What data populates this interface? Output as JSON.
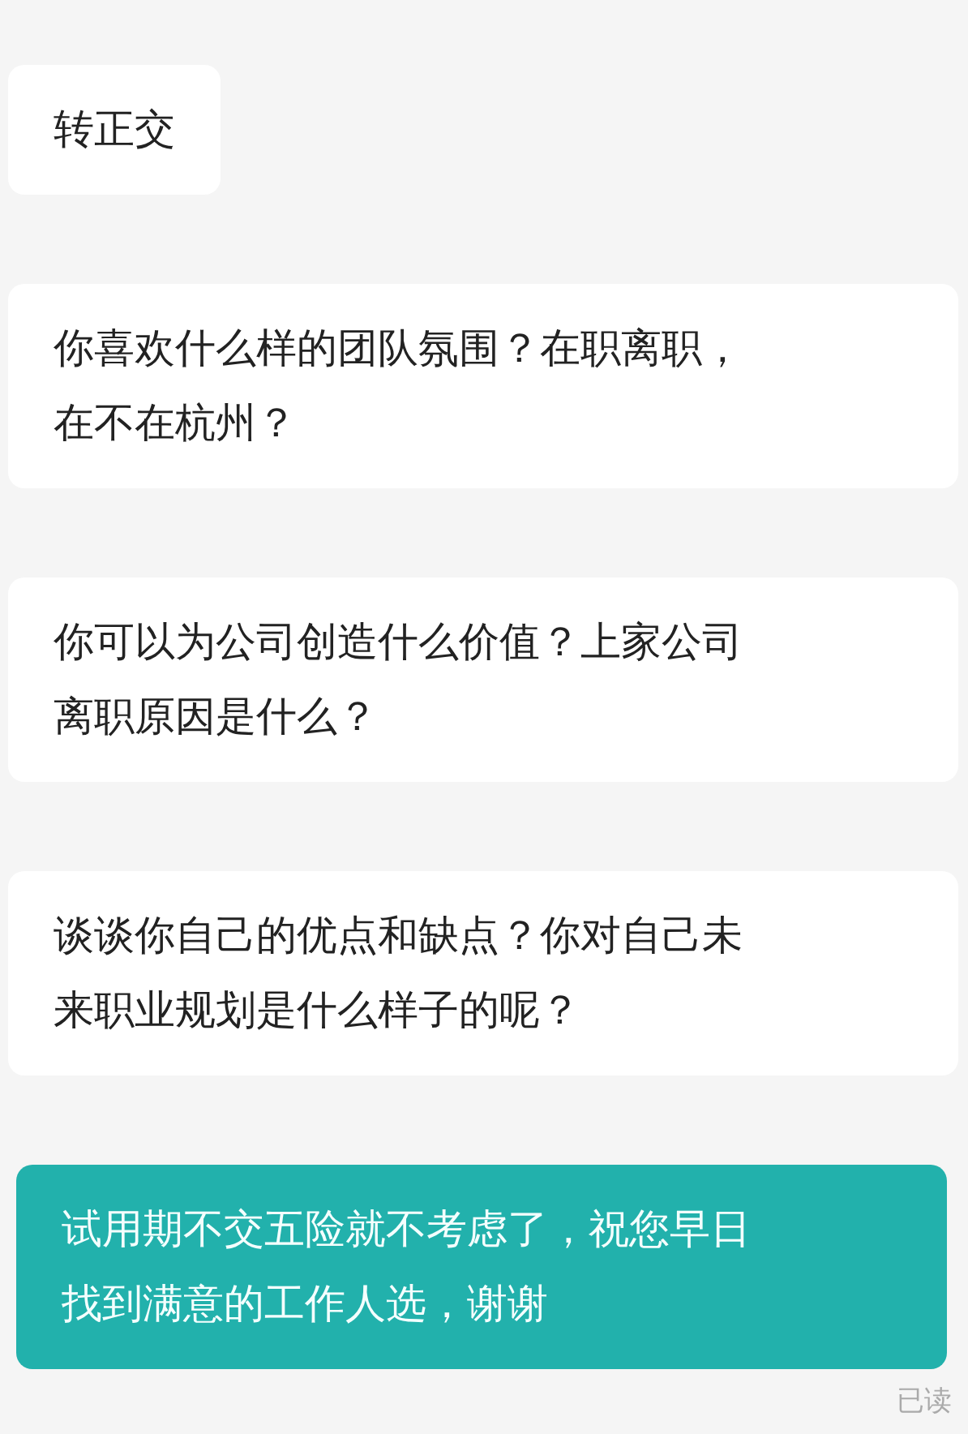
{
  "messages": [
    {
      "kind": "received",
      "lines": [
        "转正交"
      ]
    },
    {
      "kind": "received",
      "lines": [
        "你喜欢什么样的团队氛围？在职离职，",
        "在不在杭州？"
      ]
    },
    {
      "kind": "received",
      "lines": [
        "你可以为公司创造什么价值？上家公司",
        "离职原因是什么？"
      ]
    },
    {
      "kind": "received",
      "lines": [
        "谈谈你自己的优点和缺点？你对自己未",
        "来职业规划是什么样子的呢？"
      ]
    },
    {
      "kind": "sent",
      "lines": [
        "试用期不交五险就不考虑了，祝您早日",
        "找到满意的工作人选，谢谢"
      ]
    }
  ],
  "read_status": "已读"
}
